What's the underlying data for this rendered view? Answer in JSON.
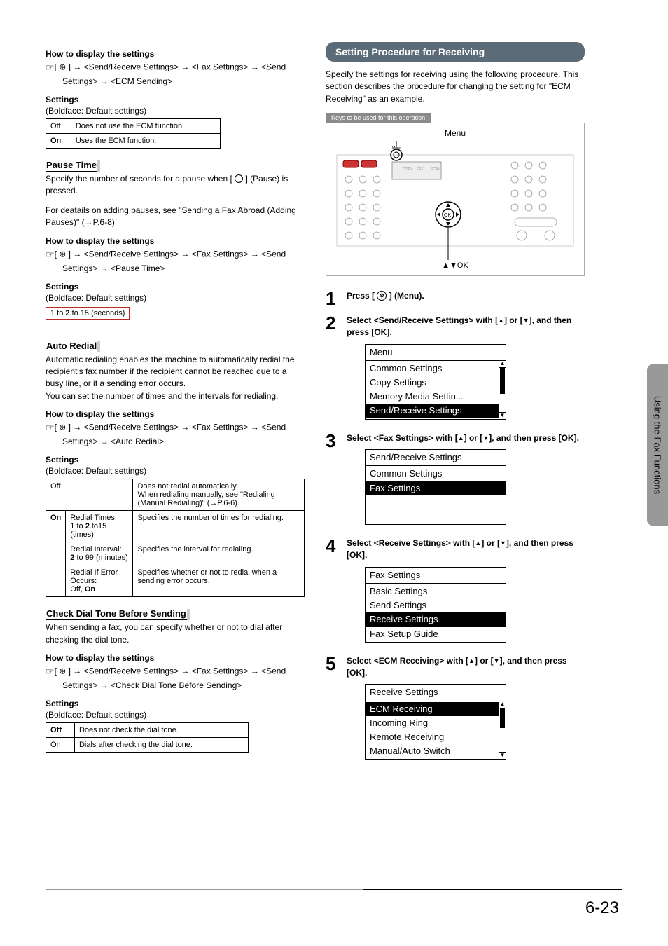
{
  "side_tab": "Using the Fax Functions",
  "page_num": "6-23",
  "left": {
    "ecm": {
      "how_heading": "How to display the settings",
      "path": "[ ⊛ ] → <Send/Receive Settings> → <Fax Settings> → <Send Settings> → <ECM Sending>",
      "settings_heading": "Settings",
      "boldface": "(Boldface: Default settings)",
      "rows": [
        [
          "Off",
          "Does not use the ECM function."
        ],
        [
          "On",
          "Uses the ECM function."
        ]
      ]
    },
    "pause": {
      "heading": "Pause Time",
      "intro": "Specify the number of seconds for a pause when [      ] (Pause) is pressed.",
      "intro2": "For deatails on adding pauses, see \"Sending a Fax Abroad (Adding Pauses)\" (→P.6-8)",
      "how_heading": "How to display the settings",
      "path": "[ ⊛ ] → <Send/Receive Settings> → <Fax Settings> → <Send Settings> → <Pause Time>",
      "settings_heading": "Settings",
      "boldface": "(Boldface: Default settings)",
      "range": "1 to 2 to 15 (seconds)"
    },
    "auto_redial": {
      "heading": "Auto Redial",
      "intro": "Automatic redialing enables the machine to automatically redial the recipient's fax number if the recipient cannot be reached due to a busy line, or if a sending error occurs.\nYou can set the number of times and the intervals for redialing.",
      "how_heading": "How to display the settings",
      "path": "[ ⊛ ] → <Send/Receive Settings> → <Fax Settings> → <Send Settings> → <Auto Redial>",
      "settings_heading": "Settings",
      "boldface": "(Boldface: Default settings)",
      "off_desc": "Does not redial automatically.\nWhen redialing manually, see \"Redialing (Manual Redialing)\" (→P.6-6).",
      "r1a": "Redial Times:\n1 to 2 to15 (times)",
      "r1b": "Specifies the number of times for redialing.",
      "r2a": "Redial Interval:\n2 to 99 (minutes)",
      "r2b": "Specifies the interval for redialing.",
      "r3a": "Redial If Error Occurs:\nOff, On",
      "r3b": "Specifies whether or not to redial when a sending error occurs."
    },
    "dial_tone": {
      "heading": "Check Dial Tone Before Sending",
      "intro": "When sending a fax, you can specify whether or not to dial after checking the dial tone.",
      "how_heading": "How to display the settings",
      "path": "[ ⊛ ] → <Send/Receive Settings> → <Fax Settings> → <Send Settings> → <Check Dial Tone Before Sending>",
      "settings_heading": "Settings",
      "boldface": "(Boldface: Default settings)",
      "rows": [
        [
          "Off",
          "Does not check the dial tone."
        ],
        [
          "On",
          "Dials after checking the dial tone."
        ]
      ]
    }
  },
  "right": {
    "bar": "Setting Procedure for Receiving",
    "intro": "Specify the settings for receiving using the following procedure. This section describes the procedure for changing the setting for \"ECM Receiving\" as an example.",
    "keys_header": "Keys to be used for this operation",
    "menu_label": "Menu",
    "arrows_label": "▲▼OK",
    "steps": {
      "s1": "Press [  ⊛  ] (Menu).",
      "s2": "Select <Send/Receive Settings> with [▲] or [▼], and then press [OK].",
      "s2_menu": {
        "title": "Menu",
        "items": [
          "Common Settings",
          "Copy Settings",
          "Memory Media Settin...",
          "Send/Receive Settings"
        ],
        "selected": 3,
        "scroll": true,
        "thumb_top": 0,
        "thumb_h": 60
      },
      "s3": "Select <Fax Settings> with [▲] or [▼], and then press [OK].",
      "s3_menu": {
        "title": "Send/Receive Settings",
        "items": [
          "Common Settings",
          "Fax Settings",
          "",
          ""
        ],
        "selected": 1,
        "scroll": false
      },
      "s4": "Select <Receive Settings> with [▲] or [▼], and then press [OK].",
      "s4_menu": {
        "title": "Fax Settings",
        "items": [
          "Basic Settings",
          "Send Settings",
          "Receive Settings",
          "Fax Setup Guide"
        ],
        "selected": 2,
        "scroll": false
      },
      "s5": "Select <ECM Receiving> with [▲] or [▼], and then press [OK].",
      "s5_menu": {
        "title": "Receive Settings",
        "items": [
          "ECM Receiving",
          "Incoming Ring",
          "Remote Receiving",
          "Manual/Auto Switch"
        ],
        "selected": 0,
        "scroll": true,
        "thumb_top": 0,
        "thumb_h": 45
      }
    }
  }
}
